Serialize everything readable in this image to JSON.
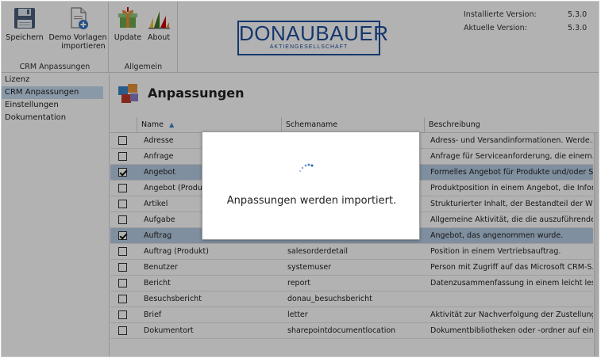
{
  "ribbon": {
    "groups": [
      {
        "label": "CRM Anpassungen"
      },
      {
        "label": "Allgemein"
      }
    ],
    "buttons": {
      "save": {
        "label": "Speichern",
        "icon": "floppy-disk-icon"
      },
      "demo": {
        "label_line1": "Demo Vorlagen",
        "label_line2": "importieren",
        "icon": "document-add-icon"
      },
      "update": {
        "label": "Update",
        "icon": "gift-box-icon"
      },
      "about": {
        "label": "About",
        "icon": "bar-chart-icon"
      }
    },
    "logo": {
      "name": "DONAUBAUER",
      "sub": "AKTIENGESELLSCHAFT",
      "color": "#1f4f9c"
    },
    "version": {
      "installed_label": "Installierte Version:",
      "installed_value": "5.3.0",
      "current_label": "Aktuelle Version:",
      "current_value": "5.3.0"
    }
  },
  "sidebar": {
    "items": [
      {
        "label": "Lizenz"
      },
      {
        "label": "CRM Anpassungen"
      },
      {
        "label": "Einstellungen"
      },
      {
        "label": "Dokumentation"
      }
    ],
    "active_index": 1,
    "active_color": "#c6dcf1"
  },
  "main": {
    "title": "Anpassungen",
    "columns": {
      "name": "Name",
      "schema": "Schemaname",
      "description": "Beschreibung"
    },
    "selected_row_color": "#b7cde4",
    "rows": [
      {
        "name": "Adresse",
        "schema": "",
        "description": "Adress- und Versandinformationen. Werde...",
        "checked": false
      },
      {
        "name": "Anfrage",
        "schema": "",
        "description": "Anfrage für Serviceanforderung, die einem...",
        "checked": false
      },
      {
        "name": "Angebot",
        "schema": "",
        "description": "Formelles Angebot für Produkte und/oder S...",
        "checked": true
      },
      {
        "name": "Angebot (Produkt)",
        "schema": "",
        "description": "Produktposition in einem Angebot, die Infor...",
        "checked": false
      },
      {
        "name": "Artikel",
        "schema": "",
        "description": "Strukturierter Inhalt, der Bestandteil der Wis...",
        "checked": false
      },
      {
        "name": "Aufgabe",
        "schema": "",
        "description": "Allgemeine Aktivität, die die auszuführende...",
        "checked": false
      },
      {
        "name": "Auftrag",
        "schema": "salesorder",
        "description": "Angebot, das angenommen wurde.",
        "checked": true
      },
      {
        "name": "Auftrag (Produkt)",
        "schema": "salesorderdetail",
        "description": "Position in einem Vertriebsauftrag.",
        "checked": false
      },
      {
        "name": "Benutzer",
        "schema": "systemuser",
        "description": "Person mit Zugriff auf das Microsoft CRM-S...",
        "checked": false
      },
      {
        "name": "Bericht",
        "schema": "report",
        "description": "Datenzusammenfassung in einem leicht les...",
        "checked": false
      },
      {
        "name": "Besuchsbericht",
        "schema": "donau_besuchsbericht",
        "description": "",
        "checked": false
      },
      {
        "name": "Brief",
        "schema": "letter",
        "description": "Aktivität zur Nachverfolgung der Zustellung...",
        "checked": false
      },
      {
        "name": "Dokumentort",
        "schema": "sharepointdocumentlocation",
        "description": "Dokumentbibliotheken oder -ordner auf ein...",
        "checked": false
      }
    ]
  },
  "modal": {
    "message": "Anpassungen werden importiert.",
    "spinner_icon": "loading-spinner-icon",
    "spinner_color": "#1f5fb4"
  }
}
